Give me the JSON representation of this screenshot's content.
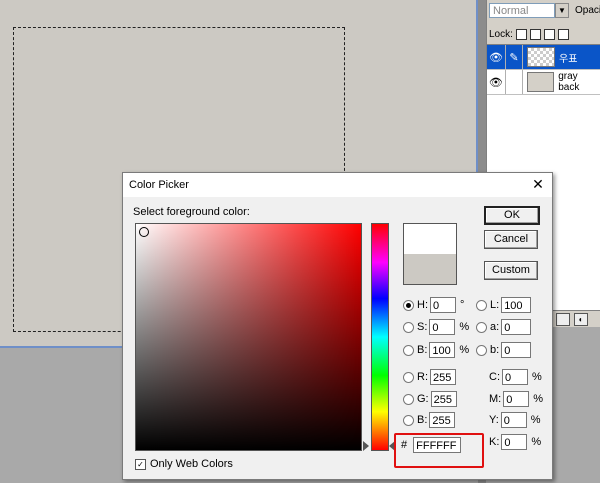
{
  "layers_panel": {
    "blend_mode": "Normal",
    "opacity_label": "Opacit",
    "lock_label": "Lock:",
    "layers": [
      {
        "name": "우표",
        "selected": true,
        "thumb": "checker"
      },
      {
        "name": "gray back",
        "selected": false,
        "thumb": "grey"
      }
    ]
  },
  "dialog": {
    "title": "Color Picker",
    "close_glyph": "✕",
    "select_label": "Select foreground color:",
    "buttons": {
      "ok": "OK",
      "cancel": "Cancel",
      "custom": "Custom"
    },
    "hsb": {
      "h": {
        "label": "H:",
        "value": "0",
        "unit": "°",
        "selected": true
      },
      "s": {
        "label": "S:",
        "value": "0",
        "unit": "%"
      },
      "b": {
        "label": "B:",
        "value": "100",
        "unit": "%"
      }
    },
    "rgb": {
      "r": {
        "label": "R:",
        "value": "255"
      },
      "g": {
        "label": "G:",
        "value": "255"
      },
      "b": {
        "label": "B:",
        "value": "255"
      }
    },
    "lab": {
      "l": {
        "label": "L:",
        "value": "100"
      },
      "a": {
        "label": "a:",
        "value": "0"
      },
      "b": {
        "label": "b:",
        "value": "0"
      }
    },
    "cmyk": {
      "c": {
        "label": "C:",
        "value": "0",
        "unit": "%"
      },
      "m": {
        "label": "M:",
        "value": "0",
        "unit": "%"
      },
      "y": {
        "label": "Y:",
        "value": "0",
        "unit": "%"
      },
      "k": {
        "label": "K:",
        "value": "0",
        "unit": "%"
      }
    },
    "hex": {
      "label": "#",
      "value": "FFFFFF"
    },
    "web_colors": {
      "label": "Only Web Colors",
      "checked": true
    },
    "colors": {
      "new": "#FFFFFF",
      "old": "#CCC9C3",
      "highlight": "#E01010"
    }
  }
}
